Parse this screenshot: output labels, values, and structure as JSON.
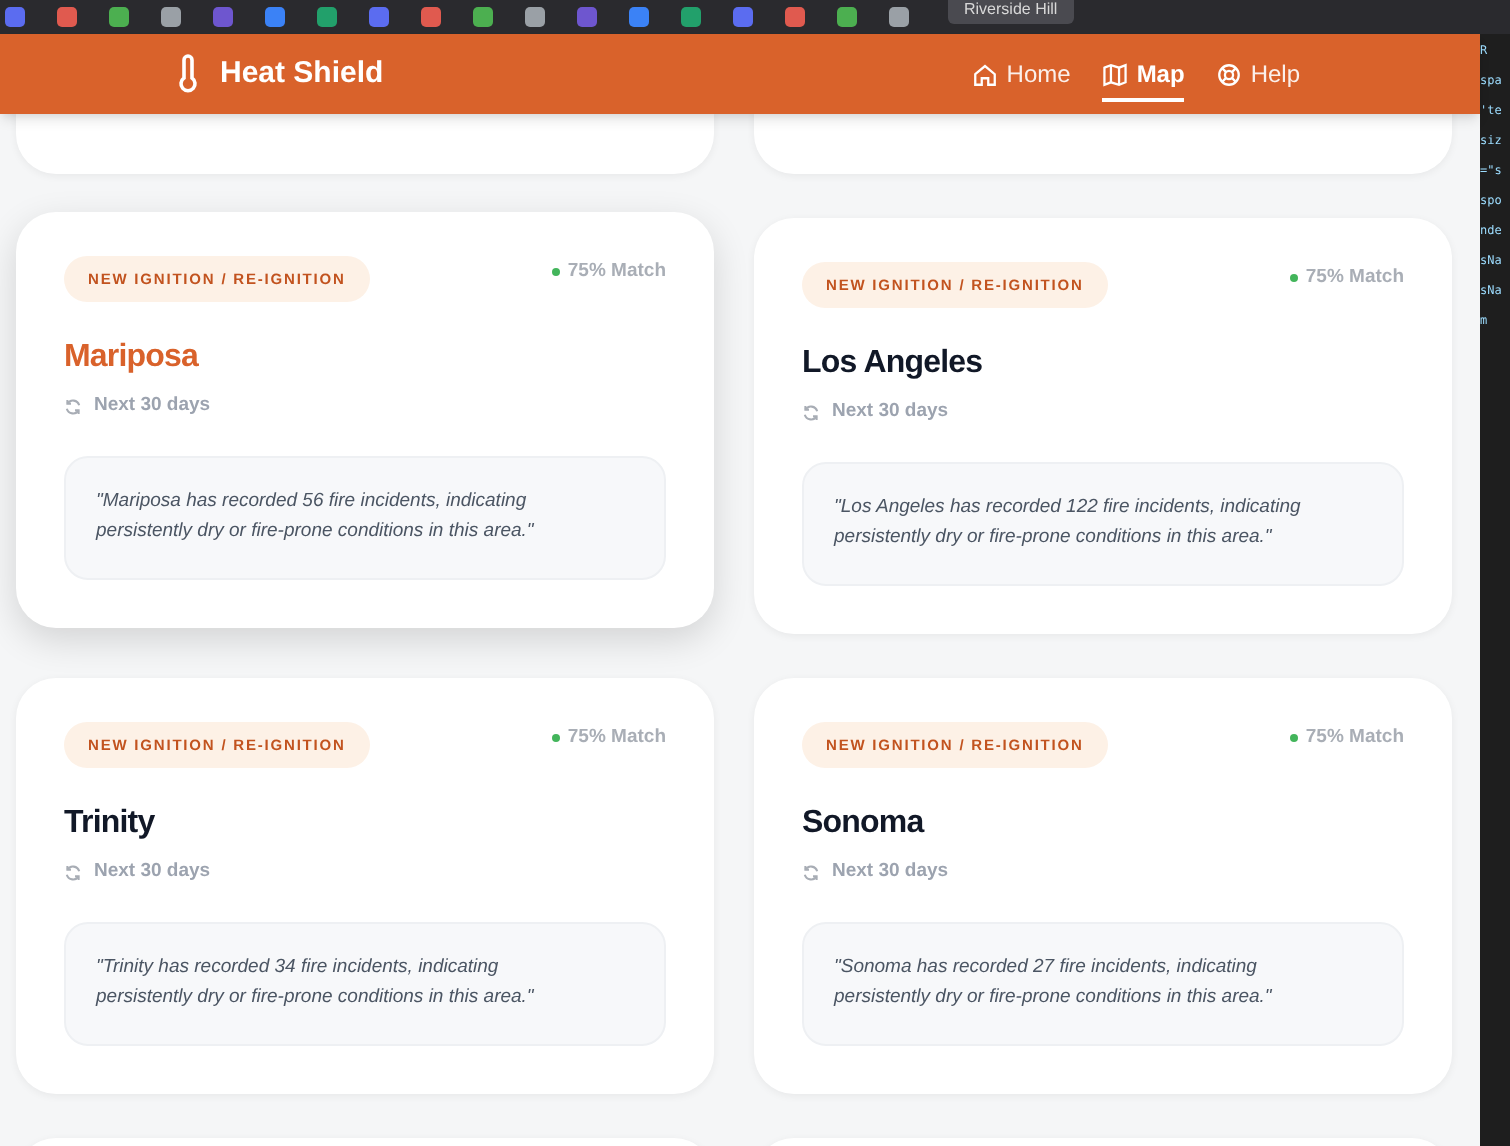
{
  "browser_tabs": {
    "active_tab": "Riverside Hill"
  },
  "header": {
    "brand": "Heat Shield",
    "nav": [
      {
        "label": "Home",
        "selected": false
      },
      {
        "label": "Map",
        "selected": true
      },
      {
        "label": "Help",
        "selected": false
      }
    ]
  },
  "cards": [
    {
      "kind": "cut"
    },
    {
      "kind": "cut"
    },
    {
      "kind": "full",
      "badge": "NEW IGNITION / RE-IGNITION",
      "match": "75% Match",
      "title": "Mariposa",
      "highlighted": true,
      "period": "Next 30 days",
      "quote": "\"Mariposa has recorded 56 fire incidents, indicating persistently dry or fire-prone conditions in this area.\""
    },
    {
      "kind": "full",
      "badge": "NEW IGNITION / RE-IGNITION",
      "match": "75% Match",
      "title": "Los Angeles",
      "highlighted": false,
      "period": "Next 30 days",
      "quote": "\"Los Angeles has recorded 122 fire incidents, indicating persistently dry or fire-prone conditions in this area.\""
    },
    {
      "kind": "full",
      "badge": "NEW IGNITION / RE-IGNITION",
      "match": "75% Match",
      "title": "Trinity",
      "highlighted": false,
      "period": "Next 30 days",
      "quote": "\"Trinity has recorded 34 fire incidents, indicating persistently dry or fire-prone conditions in this area.\""
    },
    {
      "kind": "full",
      "badge": "NEW IGNITION / RE-IGNITION",
      "match": "75% Match",
      "title": "Sonoma",
      "highlighted": false,
      "period": "Next 30 days",
      "quote": "\"Sonoma has recorded 27 fire incidents, indicating persistently dry or fire-prone conditions in this area.\""
    },
    {
      "kind": "cut"
    },
    {
      "kind": "cut"
    }
  ],
  "editor_fragments": [
    "R",
    "spa",
    "'te",
    "siz",
    "=\"s",
    "spo",
    "nde",
    "sNa",
    "sNa",
    "m"
  ]
}
